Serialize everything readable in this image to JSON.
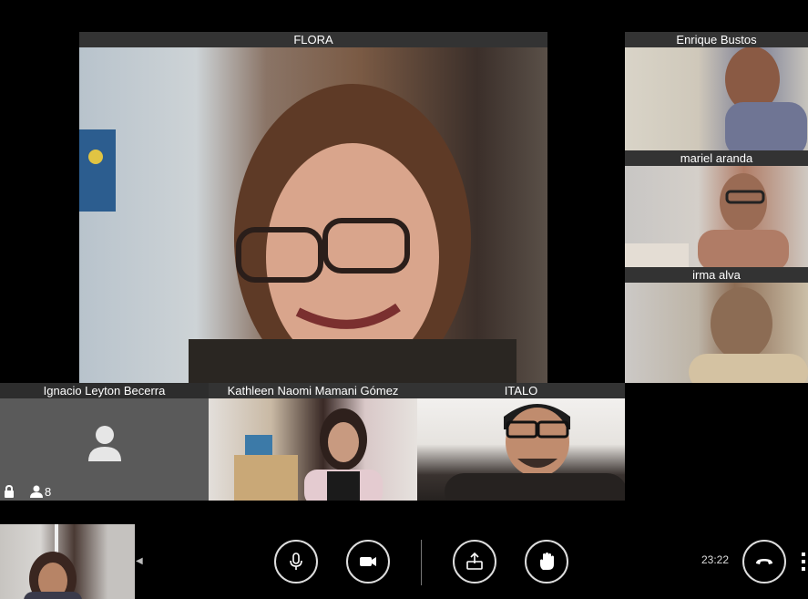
{
  "participants": {
    "flora": {
      "name": "FLORA"
    },
    "enrique": {
      "name": "Enrique Bustos"
    },
    "mariel": {
      "name": "mariel aranda"
    },
    "irma": {
      "name": "irma alva"
    },
    "ignacio": {
      "name": "Ignacio Leyton Becerra"
    },
    "kathleen": {
      "name": "Kathleen Naomi Mamani Gómez"
    },
    "italo": {
      "name": "ITALO"
    }
  },
  "status": {
    "participant_count": "8",
    "lock_icon": "lock-icon",
    "people_icon": "people-icon"
  },
  "toolbar": {
    "mic_icon": "microphone-icon",
    "camera_icon": "camera-icon",
    "share_icon": "share-screen-icon",
    "hand_icon": "raise-hand-icon",
    "hangup_icon": "hangup-icon",
    "more_icon": "more-vertical-icon",
    "clock": "23:22"
  },
  "colors": {
    "background": "#000000",
    "namebar": "#3c3c3c",
    "button_border": "#dddddd"
  }
}
